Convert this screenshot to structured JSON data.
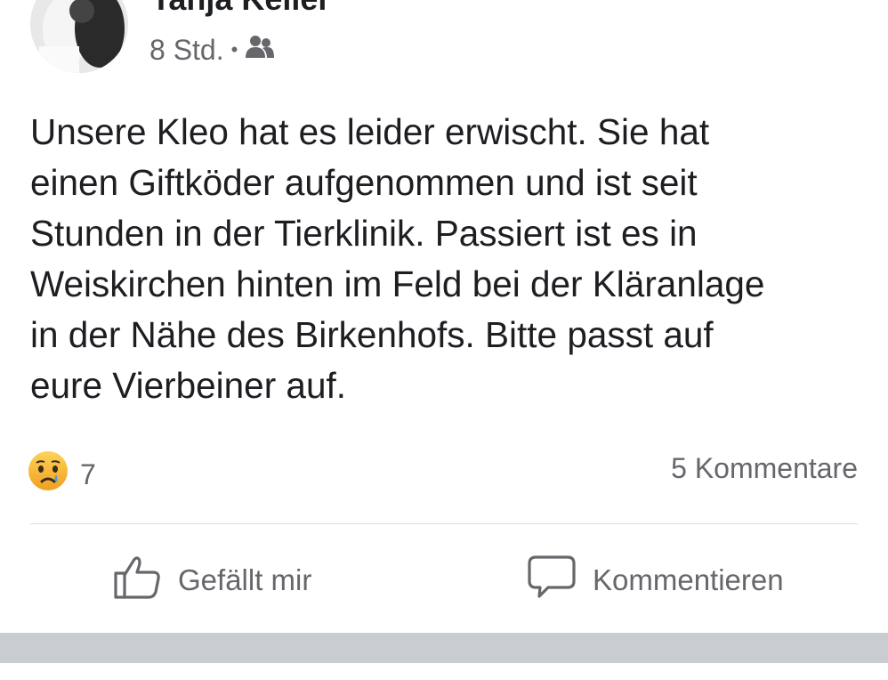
{
  "post": {
    "author": "Tanja Keller",
    "timestamp": "8 Std.",
    "separator": "•",
    "audience_icon": "friends-icon",
    "text_lines": [
      "Unsere Kleo hat es leider erwischt. Sie hat",
      "einen Giftköder aufgenommen und ist seit",
      "Stunden in der Tierklinik. Passiert ist es in",
      "Weiskirchen hinten im Feld bei der Kläranlage",
      "in der Nähe des Birkenhofs. Bitte passt auf",
      "eure Vierbeiner auf."
    ]
  },
  "reactions": {
    "icon": "sad-emoji-icon",
    "count": "7"
  },
  "comments": {
    "count_label": "5 Kommentare"
  },
  "actions": {
    "like_label": "Gefällt mir",
    "like_icon": "thumbs-up-icon",
    "comment_label": "Kommentieren",
    "comment_icon": "comment-bubble-icon"
  },
  "colors": {
    "text": "#1c1e21",
    "secondary": "#65676b",
    "divider": "#dadde1",
    "band": "#c9ccd1",
    "emoji_yellow": "#f7b125",
    "tear_blue": "#4b9be0"
  }
}
